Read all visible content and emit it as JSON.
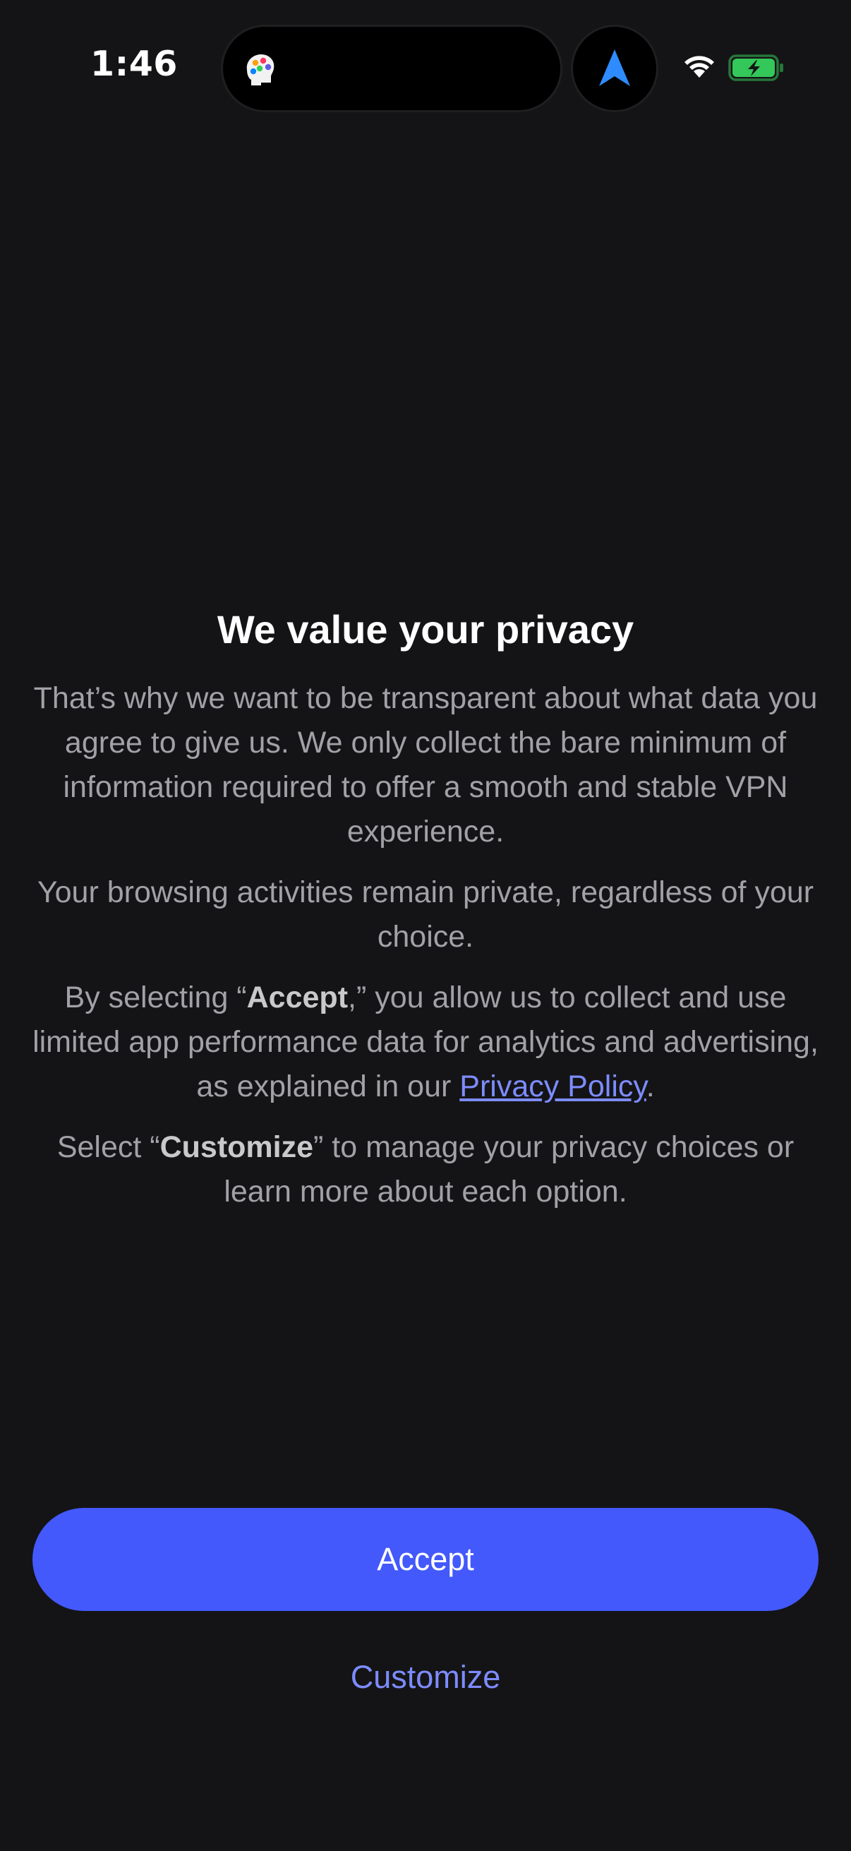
{
  "status_bar": {
    "time": "1:46",
    "app_icon": "brain-app-icon",
    "navigation_icon": "navigation-arrow-icon",
    "wifi_icon": "wifi-icon",
    "battery_icon": "battery-charging-icon"
  },
  "privacy": {
    "title": "We value your privacy",
    "para1": "That’s why we want to be transparent about what data you agree to give us. We only collect the bare minimum of information required to offer a smooth and stable VPN experience.",
    "para2": "Your browsing activities remain private, regardless of your choice.",
    "para3_prefix": "By selecting “",
    "para3_bold": "Accept",
    "para3_middle": ",” you allow us to collect and use limited app performance data for analytics and advertising, as explained in our ",
    "para3_link": "Privacy Policy",
    "para3_suffix": ".",
    "para4_prefix": "Select “",
    "para4_bold": "Customize",
    "para4_suffix": "” to manage your privacy choices or learn more about each option."
  },
  "actions": {
    "accept_label": "Accept",
    "customize_label": "Customize"
  },
  "colors": {
    "background": "#141416",
    "accent": "#4359fb",
    "link": "#7d8cff",
    "body_text": "#a1a1a6",
    "battery_green": "#34c759"
  }
}
